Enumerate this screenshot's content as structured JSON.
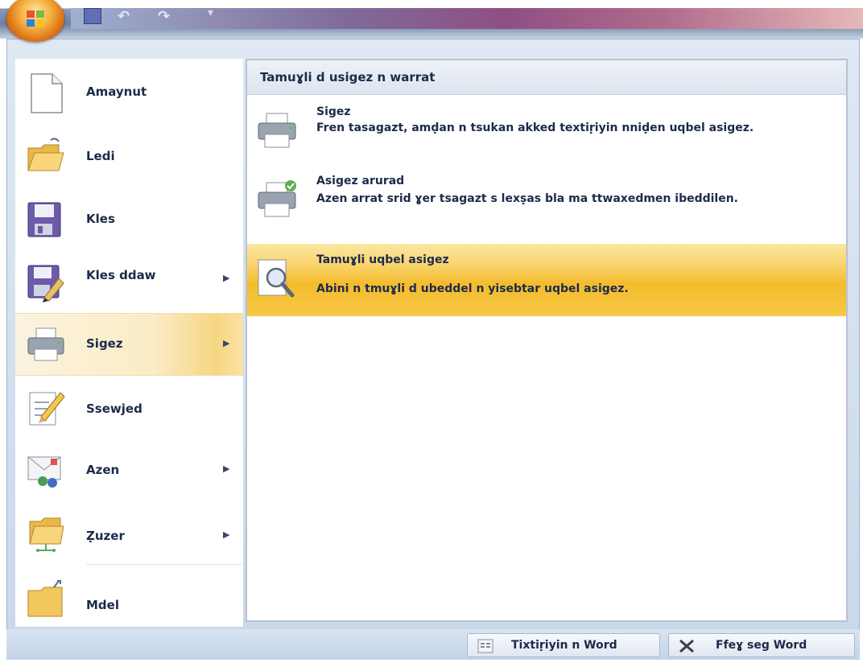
{
  "colors": {
    "accent_highlight": "#f4bb2c",
    "text": "#1b2b4a",
    "frame": "#c9d8ea"
  },
  "menu": {
    "items": [
      {
        "label": "Amaynut",
        "icon": "new-document-icon",
        "submenu": false
      },
      {
        "label": "Ledi",
        "icon": "open-folder-icon",
        "submenu": false
      },
      {
        "label": "Kles",
        "icon": "save-disk-icon",
        "submenu": false
      },
      {
        "label": "Kles ddaw",
        "icon": "save-as-icon",
        "submenu": true
      },
      {
        "label": "Sigez",
        "icon": "printer-icon",
        "submenu": true,
        "active": true
      },
      {
        "label": "Ssewjed",
        "icon": "prepare-pencil-icon",
        "submenu": false
      },
      {
        "label": "Azen",
        "icon": "send-mail-icon",
        "submenu": true
      },
      {
        "label": "Ẓuzer",
        "icon": "publish-folder-icon",
        "submenu": true
      },
      {
        "label": "Mdel",
        "icon": "close-folder-icon",
        "submenu": false
      }
    ]
  },
  "submenu": {
    "header": "Tamuɣli d usigez n warrat",
    "items": [
      {
        "title": "Sigez",
        "desc": "Fren tasagazt, amḍan n tsukan akked textiṛiyin nniḍen uqbel asigez.",
        "icon": "printer-icon"
      },
      {
        "title": "Asigez arurad",
        "desc": "Azen arrat srid ɣer tsagazt s lexṣas bla ma ttwaxedmen ibeddilen.",
        "icon": "quick-print-icon"
      },
      {
        "title": "Tamuɣli uqbel asigez",
        "desc": "Abini n tmuɣli d ubeddel n yisebtar uqbel asigez.",
        "icon": "print-preview-icon",
        "active": true
      }
    ]
  },
  "footer": {
    "options_label": "Tixtiṛiyin n Word",
    "exit_label": "Ffeɣ seg Word"
  }
}
